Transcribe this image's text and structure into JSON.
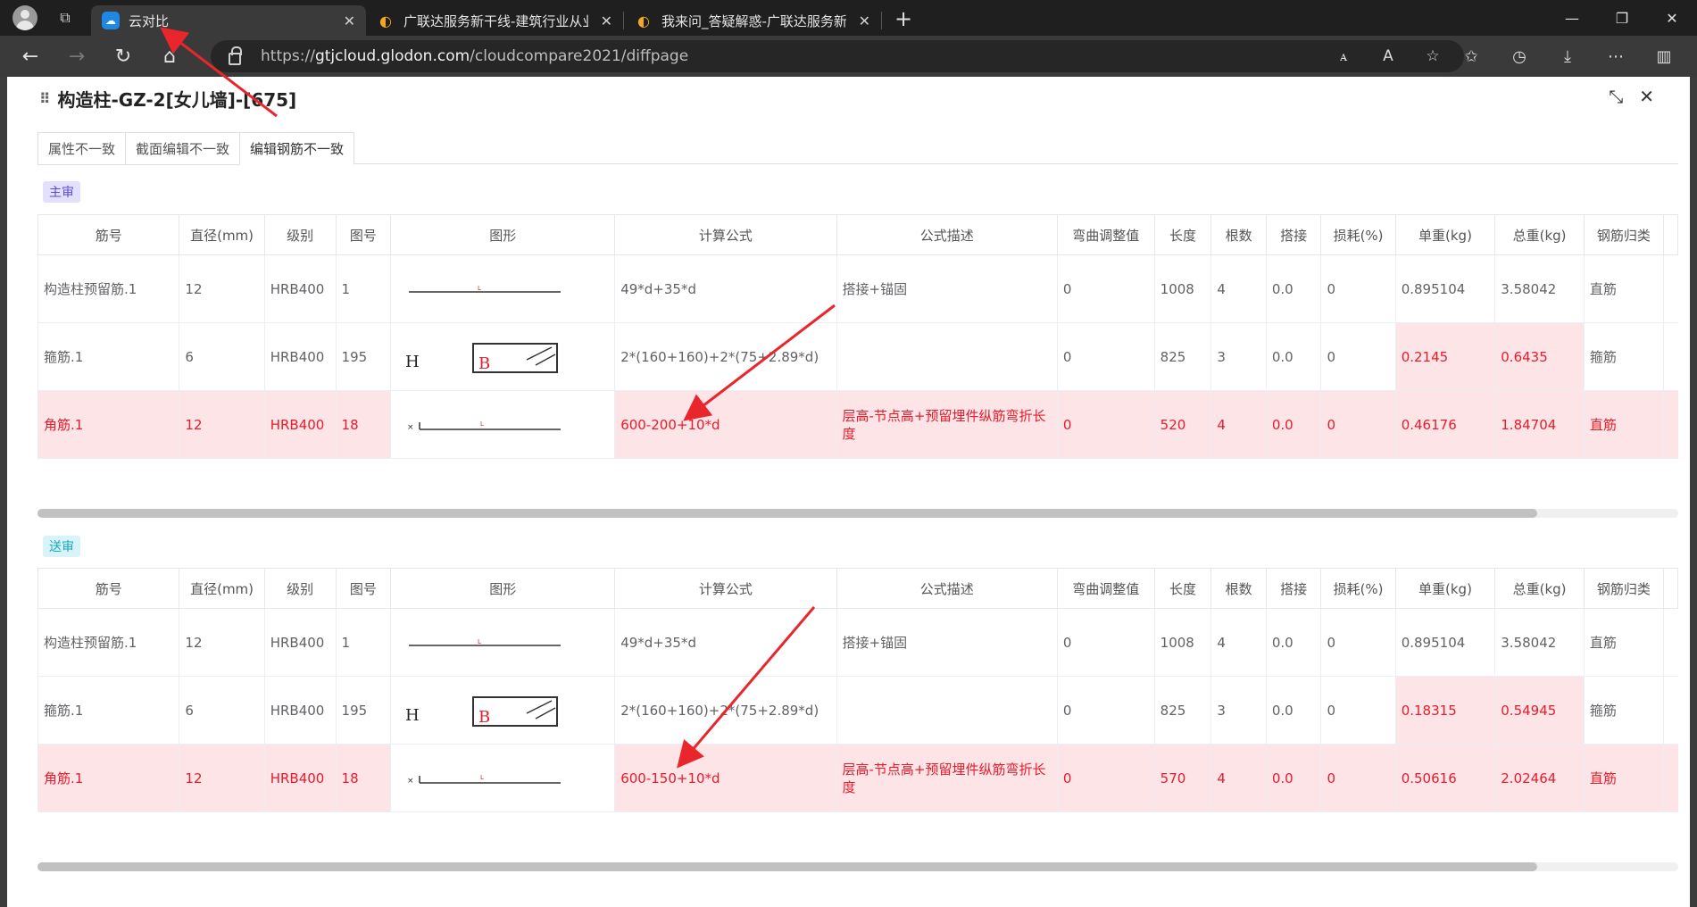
{
  "browser": {
    "tabs": [
      {
        "label": "云对比",
        "active": true
      },
      {
        "label": "广联达服务新干线-建筑行业从业",
        "active": false
      },
      {
        "label": "我来问_答疑解惑-广联达服务新",
        "active": false
      }
    ],
    "url_prefix": "https://",
    "url_host": "gtjcloud.glodon.com",
    "url_path": "/cloudcompare2021/diffpage"
  },
  "dialog": {
    "title": "构造柱-GZ-2[女儿墙]-[675]",
    "tabs": [
      "属性不一致",
      "截面编辑不一致",
      "编辑钢筋不一致"
    ],
    "active_tab": 2
  },
  "columns": [
    "筋号",
    "直径(mm)",
    "级别",
    "图号",
    "图形",
    "计算公式",
    "公式描述",
    "弯曲调整值",
    "长度",
    "根数",
    "搭接",
    "损耗(%)",
    "单重(kg)",
    "总重(kg)",
    "钢筋归类"
  ],
  "main_review": {
    "label": "主审",
    "rows": [
      {
        "name": "构造柱预留筋.1",
        "dia": "12",
        "grade": "HRB400",
        "fig": "1",
        "formula": "49*d+35*d",
        "desc": "搭接+锚固",
        "bend": "0",
        "length": "1008",
        "count": "4",
        "lap": "0.0",
        "loss": "0",
        "unit_w": "0.895104",
        "total_w": "3.58042",
        "category": "直筋"
      },
      {
        "name": "箍筋.1",
        "dia": "6",
        "grade": "HRB400",
        "fig": "195",
        "formula": "2*(160+160)+2*(75+2.89*d)",
        "desc": "",
        "bend": "0",
        "length": "825",
        "count": "3",
        "lap": "0.0",
        "loss": "0",
        "unit_w": "0.2145",
        "total_w": "0.6435",
        "category": "箍筋"
      },
      {
        "name": "角筋.1",
        "dia": "12",
        "grade": "HRB400",
        "fig": "18",
        "formula": "600-200+10*d",
        "desc": "层高-节点高+预留埋件纵筋弯折长度",
        "bend": "0",
        "length": "520",
        "count": "4",
        "lap": "0.0",
        "loss": "0",
        "unit_w": "0.46176",
        "total_w": "1.84704",
        "category": "直筋"
      }
    ]
  },
  "send_review": {
    "label": "送审",
    "rows": [
      {
        "name": "构造柱预留筋.1",
        "dia": "12",
        "grade": "HRB400",
        "fig": "1",
        "formula": "49*d+35*d",
        "desc": "搭接+锚固",
        "bend": "0",
        "length": "1008",
        "count": "4",
        "lap": "0.0",
        "loss": "0",
        "unit_w": "0.895104",
        "total_w": "3.58042",
        "category": "直筋"
      },
      {
        "name": "箍筋.1",
        "dia": "6",
        "grade": "HRB400",
        "fig": "195",
        "formula": "2*(160+160)+2*(75+2.89*d)",
        "desc": "",
        "bend": "0",
        "length": "825",
        "count": "3",
        "lap": "0.0",
        "loss": "0",
        "unit_w": "0.18315",
        "total_w": "0.54945",
        "category": "箍筋"
      },
      {
        "name": "角筋.1",
        "dia": "12",
        "grade": "HRB400",
        "fig": "18",
        "formula": "600-150+10*d",
        "desc": "层高-节点高+预留埋件纵筋弯折长度",
        "bend": "0",
        "length": "570",
        "count": "4",
        "lap": "0.0",
        "loss": "0",
        "unit_w": "0.50616",
        "total_w": "2.02464",
        "category": "直筋"
      }
    ]
  },
  "shape_labels": {
    "h": "H",
    "b": "B"
  },
  "colors": {
    "diff_bg": "#fde4e7",
    "diff_text": "#e81b2b",
    "arrow": "#e8262b"
  }
}
